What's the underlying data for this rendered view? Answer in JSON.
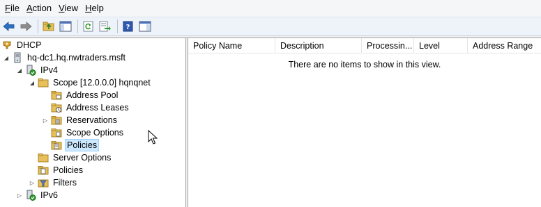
{
  "menu": {
    "file": {
      "accel": "F",
      "rest": "ile"
    },
    "action": {
      "accel": "A",
      "rest": "ction"
    },
    "view": {
      "accel": "V",
      "rest": "iew"
    },
    "help": {
      "accel": "H",
      "rest": "elp"
    }
  },
  "toolbar": {
    "icons": [
      "back-arrow-icon",
      "forward-arrow-icon",
      "up-folder-icon",
      "show-hide-console-tree-icon",
      "refresh-icon",
      "export-list-icon",
      "help-icon",
      "show-hide-action-pane-icon"
    ]
  },
  "tree": {
    "dhcp": "DHCP",
    "server": "hq-dc1.hq.nwtraders.msft",
    "ipv4": "IPv4",
    "scope": "Scope [12.0.0.0] hqnqnet",
    "address_pool": "Address Pool",
    "address_leases": "Address Leases",
    "reservations": "Reservations",
    "scope_options": "Scope Options",
    "scope_policies": "Policies",
    "server_options": "Server Options",
    "policies": "Policies",
    "filters": "Filters",
    "ipv6": "IPv6"
  },
  "list": {
    "columns": [
      "Policy Name",
      "Description",
      "Processin...",
      "Level",
      "Address Range"
    ],
    "empty_message": "There are no items to show in this view."
  },
  "colors": {
    "selection": "#cce8ff",
    "selection_border": "#99d1ff",
    "folder": "#e8c05a",
    "arrow_blue": "#2b6fc2"
  }
}
